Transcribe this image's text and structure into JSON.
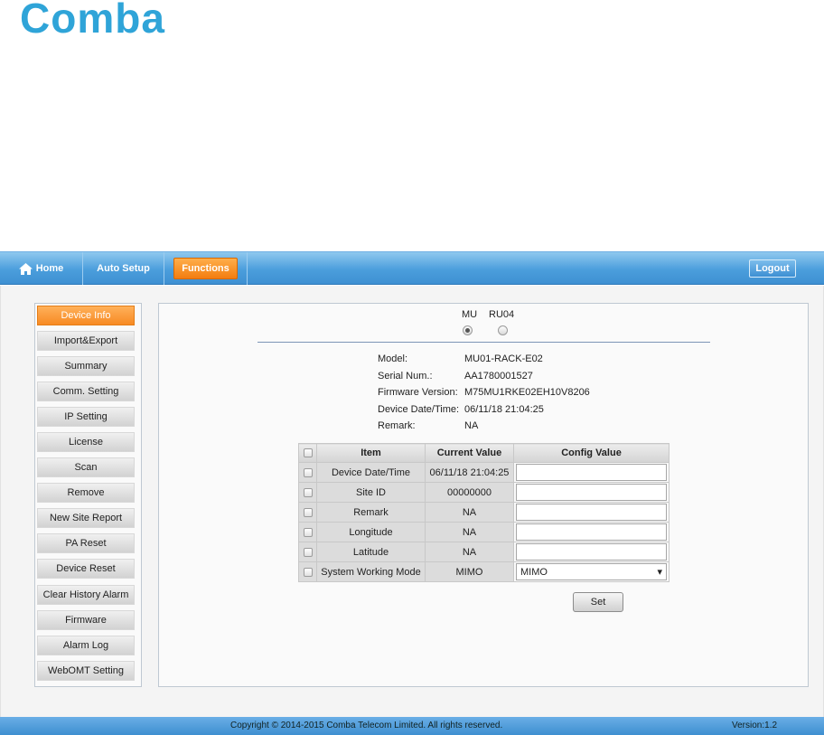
{
  "brand": {
    "logo_text": "Comba",
    "color": "#2fa4d8"
  },
  "topnav": {
    "home": "Home",
    "auto_setup": "Auto Setup",
    "functions": "Functions",
    "logout": "Logout"
  },
  "sidebar": {
    "items": [
      {
        "label": "Device Info",
        "active": true
      },
      {
        "label": "Import&Export"
      },
      {
        "label": "Summary"
      },
      {
        "label": "Comm. Setting"
      },
      {
        "label": "IP Setting"
      },
      {
        "label": "License"
      },
      {
        "label": "Scan"
      },
      {
        "label": "Remove"
      },
      {
        "label": "New Site Report"
      },
      {
        "label": "PA Reset"
      },
      {
        "label": "Device Reset"
      },
      {
        "label": "Clear History Alarm"
      },
      {
        "label": "Firmware"
      },
      {
        "label": "Alarm Log"
      },
      {
        "label": "WebOMT Setting"
      }
    ]
  },
  "device_select": {
    "options": [
      "MU",
      "RU04"
    ],
    "selected": "MU"
  },
  "info": {
    "model_label": "Model:",
    "model": "MU01-RACK-E02",
    "serial_label": "Serial Num.:",
    "serial": "AA1780001527",
    "firmware_label": "Firmware Version:",
    "firmware": "M75MU1RKE02EH10V8206",
    "datetime_label": "Device Date/Time:",
    "datetime": "06/11/18 21:04:25",
    "remark_label": "Remark:",
    "remark": "NA"
  },
  "table": {
    "headers": [
      "Item",
      "Current Value",
      "Config Value"
    ],
    "rows": [
      {
        "item": "Device Date/Time",
        "current": "06/11/18 21:04:25",
        "config": ""
      },
      {
        "item": "Site ID",
        "current": "00000000",
        "config": ""
      },
      {
        "item": "Remark",
        "current": "NA",
        "config": ""
      },
      {
        "item": "Longitude",
        "current": "NA",
        "config": ""
      },
      {
        "item": "Latitude",
        "current": "NA",
        "config": ""
      },
      {
        "item": "System Working Mode",
        "current": "MIMO",
        "config": "MIMO"
      }
    ]
  },
  "set_button": "Set",
  "footer": {
    "copyright": "Copyright © 2014-2015 Comba Telecom Limited. All rights reserved.",
    "version": "Version:1.2"
  }
}
